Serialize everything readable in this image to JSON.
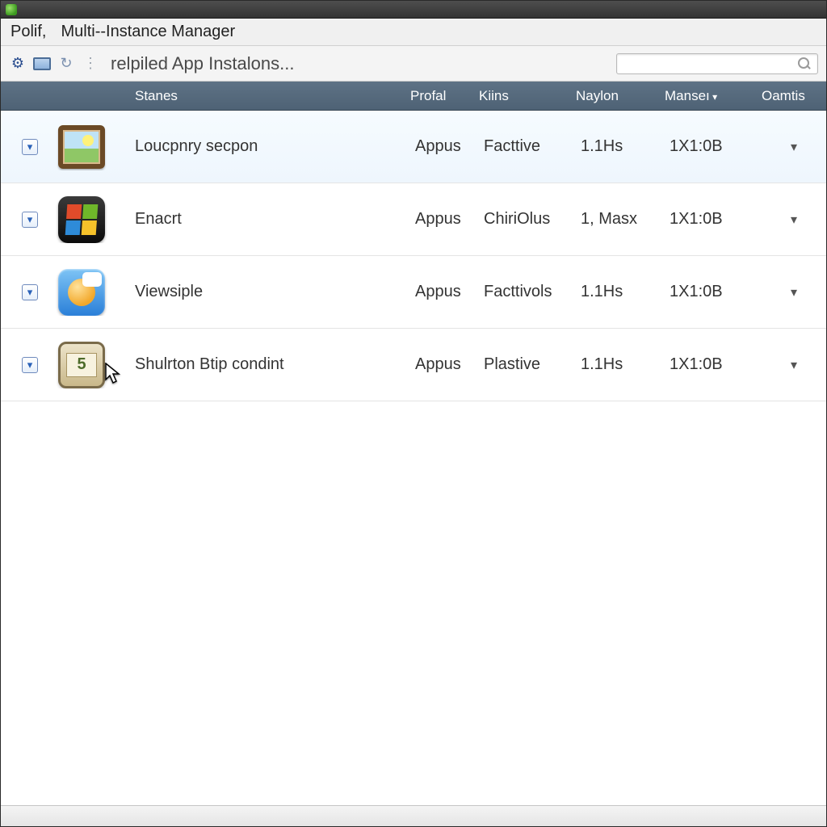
{
  "titlebar": {
    "text": ""
  },
  "menubar": {
    "items": [
      "Polif,",
      "Multi--Instance Manager"
    ]
  },
  "toolbar": {
    "title": "relpiled App Instalons...",
    "search_placeholder": ""
  },
  "columns": {
    "c0": "",
    "c1": "",
    "c2": "Stanes",
    "c3": "Profal",
    "c4": "Kiins",
    "c5": "Naylon",
    "c6": "Manseı",
    "c7": "Oamtis"
  },
  "rows": [
    {
      "name": "Loucpnry secpon",
      "profal": "Appus",
      "kins": "Facttive",
      "naylon": "1.1Hs",
      "manse": "1X1:0B",
      "icon": "frame"
    },
    {
      "name": "Enacrt",
      "profal": "Appus",
      "kins": "ChiriOlus",
      "naylon": "1, Masx",
      "manse": "1X1:0B",
      "icon": "win"
    },
    {
      "name": "Viewsiple",
      "profal": "Appus",
      "kins": "Facttivols",
      "naylon": "1.1Hs",
      "manse": "1X1:0B",
      "icon": "chat"
    },
    {
      "name": "Shulrton Btip condint",
      "profal": "Appus",
      "kins": "Plastive",
      "naylon": "1.1Hs",
      "manse": "1X1:0B",
      "icon": "cert"
    }
  ]
}
